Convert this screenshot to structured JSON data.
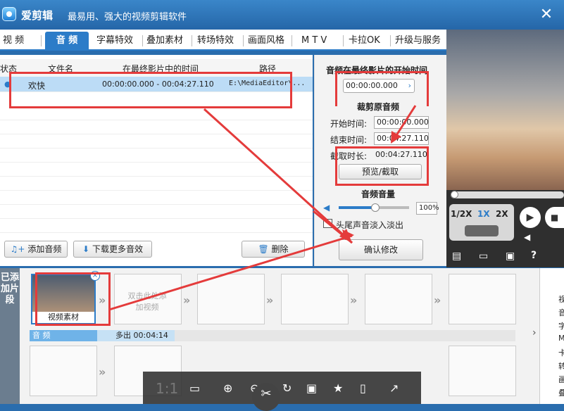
{
  "app": {
    "title": "爱剪辑",
    "subtitle": "最易用、强大的视频剪辑软件"
  },
  "tabs": [
    {
      "label": "视 频"
    },
    {
      "label": "音 频"
    },
    {
      "label": "字幕特效"
    },
    {
      "label": "叠加素材"
    },
    {
      "label": "转场特效"
    },
    {
      "label": "画面风格"
    },
    {
      "label": "M T V"
    },
    {
      "label": "卡拉OK"
    },
    {
      "label": "升级与服务"
    }
  ],
  "list": {
    "headers": [
      "状态",
      "文件名",
      "在最终影片中的时间",
      "路径"
    ],
    "rows": [
      {
        "name": "欢快",
        "time": "00:00:00.000 - 00:04:27.110",
        "path": "E:\\MediaEditor\\..."
      }
    ]
  },
  "buttons": {
    "add_audio": "添加音频",
    "download": "下载更多音效",
    "delete": "删除"
  },
  "side": {
    "start_title": "音频在最终影片的开始时间",
    "start_value": "00:00:00.000",
    "trim_title": "裁剪原音频",
    "start_label": "开始时间:",
    "start_time": "00:00:00.000",
    "end_label": "结束时间:",
    "end_time": "00:04:27.110",
    "dur_label": "截取时长:",
    "dur_value": "00:04:27.110",
    "preview_btn": "预览/截取",
    "vol_title": "音频音量",
    "vol_value": "100%",
    "fade_label": "头尾声音淡入淡出",
    "confirm": "确认修改"
  },
  "player": {
    "speeds": [
      "1/2X",
      "1X",
      "2X"
    ]
  },
  "timeline": {
    "side_label": "已添加片段",
    "clip_label": "视频素材",
    "add_hint": "双击此处添加视频",
    "audio_label": "音 频",
    "audio_extra": "多出 00:04:14"
  },
  "toolbar": {
    "ratio": "1:1"
  },
  "right_col": [
    "视",
    "音",
    "字",
    "M",
    "卡",
    "转",
    "画",
    "叠"
  ]
}
